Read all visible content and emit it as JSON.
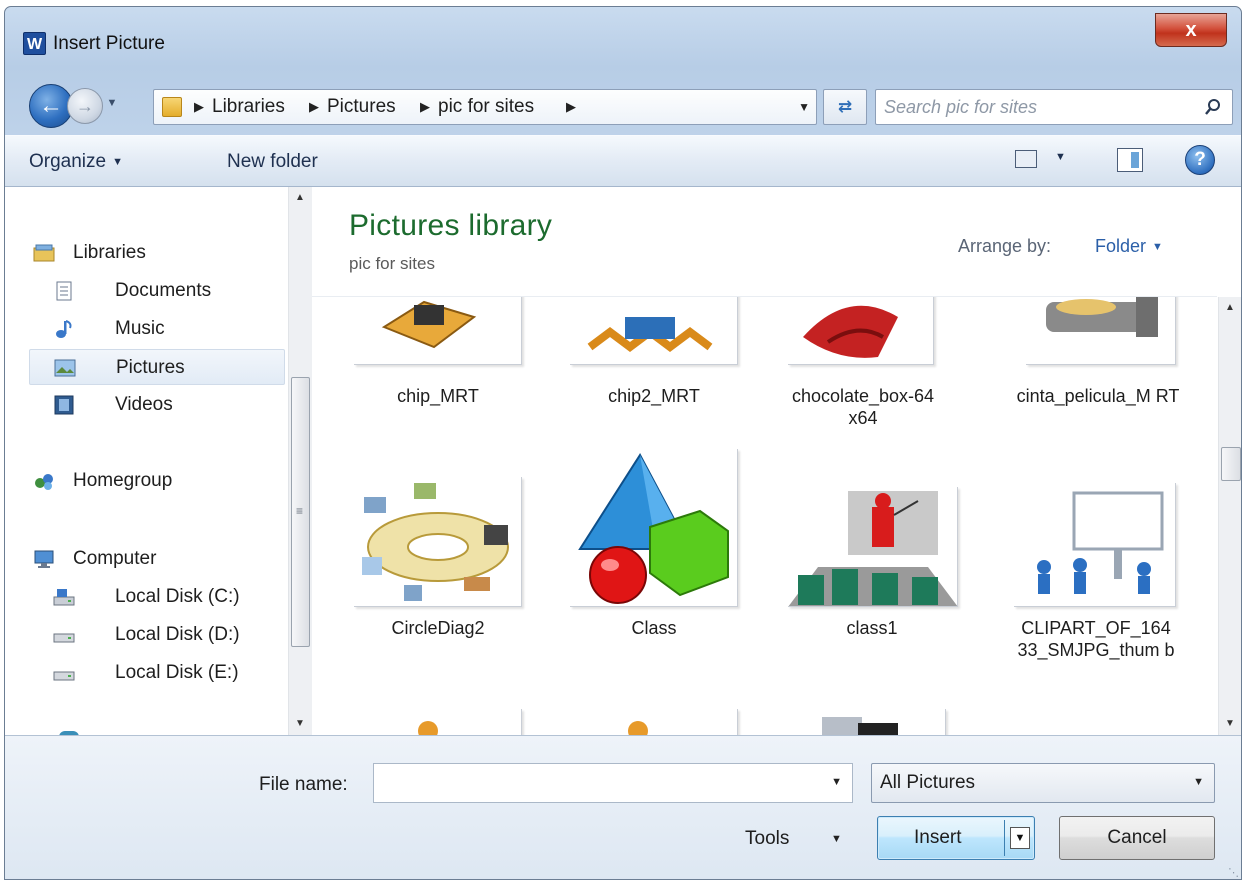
{
  "window": {
    "title": "Insert Picture",
    "app_icon": "W",
    "close_label": "x"
  },
  "address": {
    "crumbs": [
      "Libraries",
      "Pictures",
      "pic for sites"
    ],
    "search_placeholder": "Search pic for sites"
  },
  "toolbar": {
    "organize": "Organize",
    "new_folder": "New folder"
  },
  "nav": {
    "libraries": "Libraries",
    "documents": "Documents",
    "music": "Music",
    "pictures": "Pictures",
    "videos": "Videos",
    "homegroup": "Homegroup",
    "computer": "Computer",
    "disk_c": "Local Disk (C:)",
    "disk_d": "Local Disk (D:)",
    "disk_e": "Local Disk (E:)"
  },
  "content": {
    "title": "Pictures library",
    "subtitle": "pic for sites",
    "arrange_label": "Arrange by:",
    "arrange_value": "Folder",
    "files": [
      {
        "name": "chip_MRT"
      },
      {
        "name": "chip2_MRT"
      },
      {
        "name": "chocolate_box-64 x64"
      },
      {
        "name": "cinta_pelicula_M RT"
      },
      {
        "name": "CircleDiag2"
      },
      {
        "name": "Class"
      },
      {
        "name": "class1"
      },
      {
        "name": "CLIPART_OF_164 33_SMJPG_thum b"
      }
    ]
  },
  "bottom": {
    "file_name_label": "File name:",
    "file_name_value": "",
    "filter": "All Pictures",
    "tools": "Tools",
    "insert": "Insert",
    "cancel": "Cancel"
  },
  "colors": {
    "library_title": "#1c6b2e",
    "accent_link": "#2b5fa8",
    "close": "#c0321c"
  }
}
